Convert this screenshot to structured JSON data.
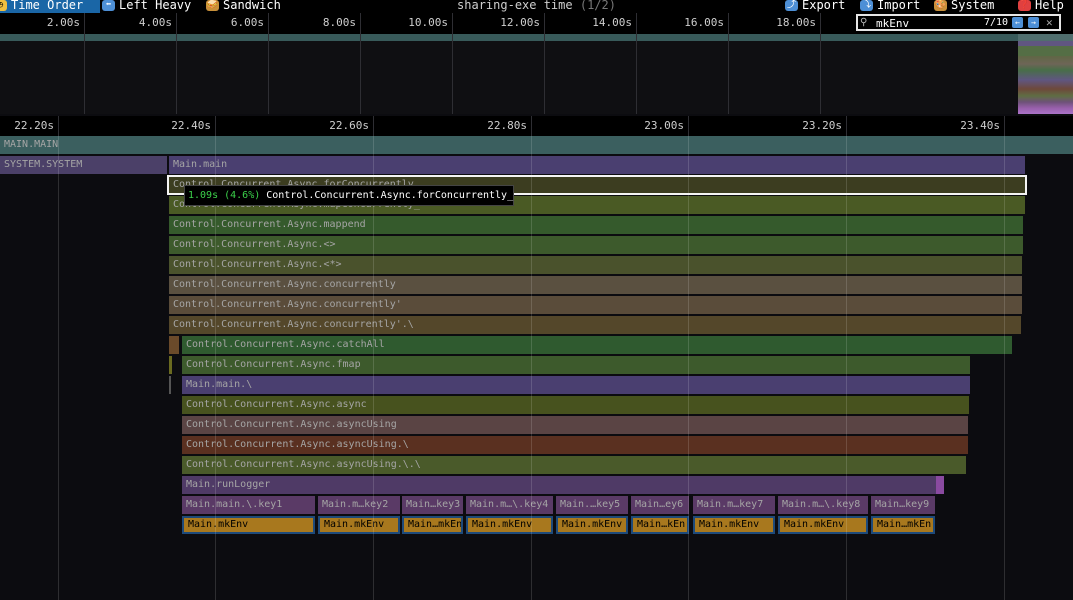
{
  "toolbar": {
    "buttons": [
      {
        "label": "Time Order",
        "icon": "clock-icon",
        "glyph": "◷",
        "icon_color": "#f0c040"
      },
      {
        "label": "Left Heavy",
        "icon": "arrow-left-icon",
        "glyph": "⬅",
        "icon_color": "#4d8fd6"
      },
      {
        "label": "Sandwich",
        "icon": "sandwich-icon",
        "glyph": "🥪",
        "icon_color": "#c8903a"
      },
      {
        "label": "Export",
        "icon": "export-icon",
        "glyph": "⤴",
        "icon_color": "#4d8fd6"
      },
      {
        "label": "Import",
        "icon": "import-icon",
        "glyph": "⤵",
        "icon_color": "#4d8fd6"
      },
      {
        "label": "System",
        "icon": "palette-icon",
        "glyph": "🎨",
        "icon_color": "#c8903a"
      },
      {
        "label": "Help",
        "icon": "question-icon",
        "glyph": "❓",
        "icon_color": "#e04040"
      }
    ],
    "title": "sharing-exe time",
    "title_sub": "(1/2)"
  },
  "search": {
    "value": "mkEnv",
    "count": "7/10",
    "icons": [
      "search-icon",
      "prev-result-icon",
      "next-result-icon",
      "clear-search-icon"
    ]
  },
  "minimap": {
    "ticks": [
      "2.00s",
      "4.00s",
      "6.00s",
      "8.00s",
      "10.00s",
      "12.00s",
      "14.00s",
      "16.00s",
      "18.00s"
    ]
  },
  "ruler": {
    "ticks": [
      "22.20s",
      "22.40s",
      "22.60s",
      "22.80s",
      "23.00s",
      "23.20s",
      "23.40s"
    ]
  },
  "frames": [
    {
      "label": "MAIN.MAIN",
      "color": "#3b5f5f"
    },
    {
      "label": "SYSTEM.SYSTEM",
      "color": "#4b4068"
    },
    {
      "label": "Main.main",
      "color": "#4a3f70"
    },
    {
      "label": "Control.Concurrent.Async.forConcurrently_",
      "color": "#3c3d20"
    },
    {
      "label": "Control.Concurrent.Async.mapConcurrently_",
      "color": "#4a5a24"
    },
    {
      "label": "Control.Concurrent.Async.mappend",
      "color": "#355a2c"
    },
    {
      "label": "Control.Concurrent.Async.<>",
      "color": "#3d5a2c"
    },
    {
      "label": "Control.Concurrent.Async.<*>",
      "color": "#4a522c"
    },
    {
      "label": "Control.Concurrent.Async.concurrently",
      "color": "#5a5040"
    },
    {
      "label": "Control.Concurrent.Async.concurrently'",
      "color": "#5a4c3a"
    },
    {
      "label": "Control.Concurrent.Async.concurrently'.\\",
      "color": "#54472a"
    },
    {
      "label": "Control.Concurrent.Async.catchAll",
      "color": "#2f5a2f"
    },
    {
      "label": "Control.Concurrent.Async.fmap",
      "color": "#3d5a2c"
    },
    {
      "label": "Main.main.\\",
      "color": "#4a3f70"
    },
    {
      "label": "Control.Concurrent.Async.async",
      "color": "#47521e"
    },
    {
      "label": "Control.Concurrent.Async.asyncUsing",
      "color": "#5a4444"
    },
    {
      "label": "Control.Concurrent.Async.asyncUsing.\\",
      "color": "#5a3020"
    },
    {
      "label": "Control.Concurrent.Async.asyncUsing.\\.\\",
      "color": "#4a5a2a"
    },
    {
      "label": "Main.runLogger",
      "color": "#4f3a66"
    }
  ],
  "key_frames": [
    "Main.main.\\.key1",
    "Main.m…key2",
    "Main…key3",
    "Main.m…\\.key4",
    "Main.…key5",
    "Main…ey6",
    "Main.m…key7",
    "Main.m…\\.key8",
    "Main…key9"
  ],
  "env_frames": [
    "Main.mkEnv",
    "Main.mkEnv",
    "Main…mkEn",
    "Main.mkEnv",
    "Main.mkEnv",
    "Main…kEn",
    "Main.mkEnv",
    "Main.mkEnv",
    "Main…mkEn"
  ],
  "colors": {
    "key_frame": "#5a3a66",
    "env_frame": "#a8781e",
    "highlight_border": "#1e4a7a"
  },
  "tooltip": {
    "time": "1.09s (4.6%)",
    "name": "Control.Concurrent.Async.forConcurrently_"
  }
}
